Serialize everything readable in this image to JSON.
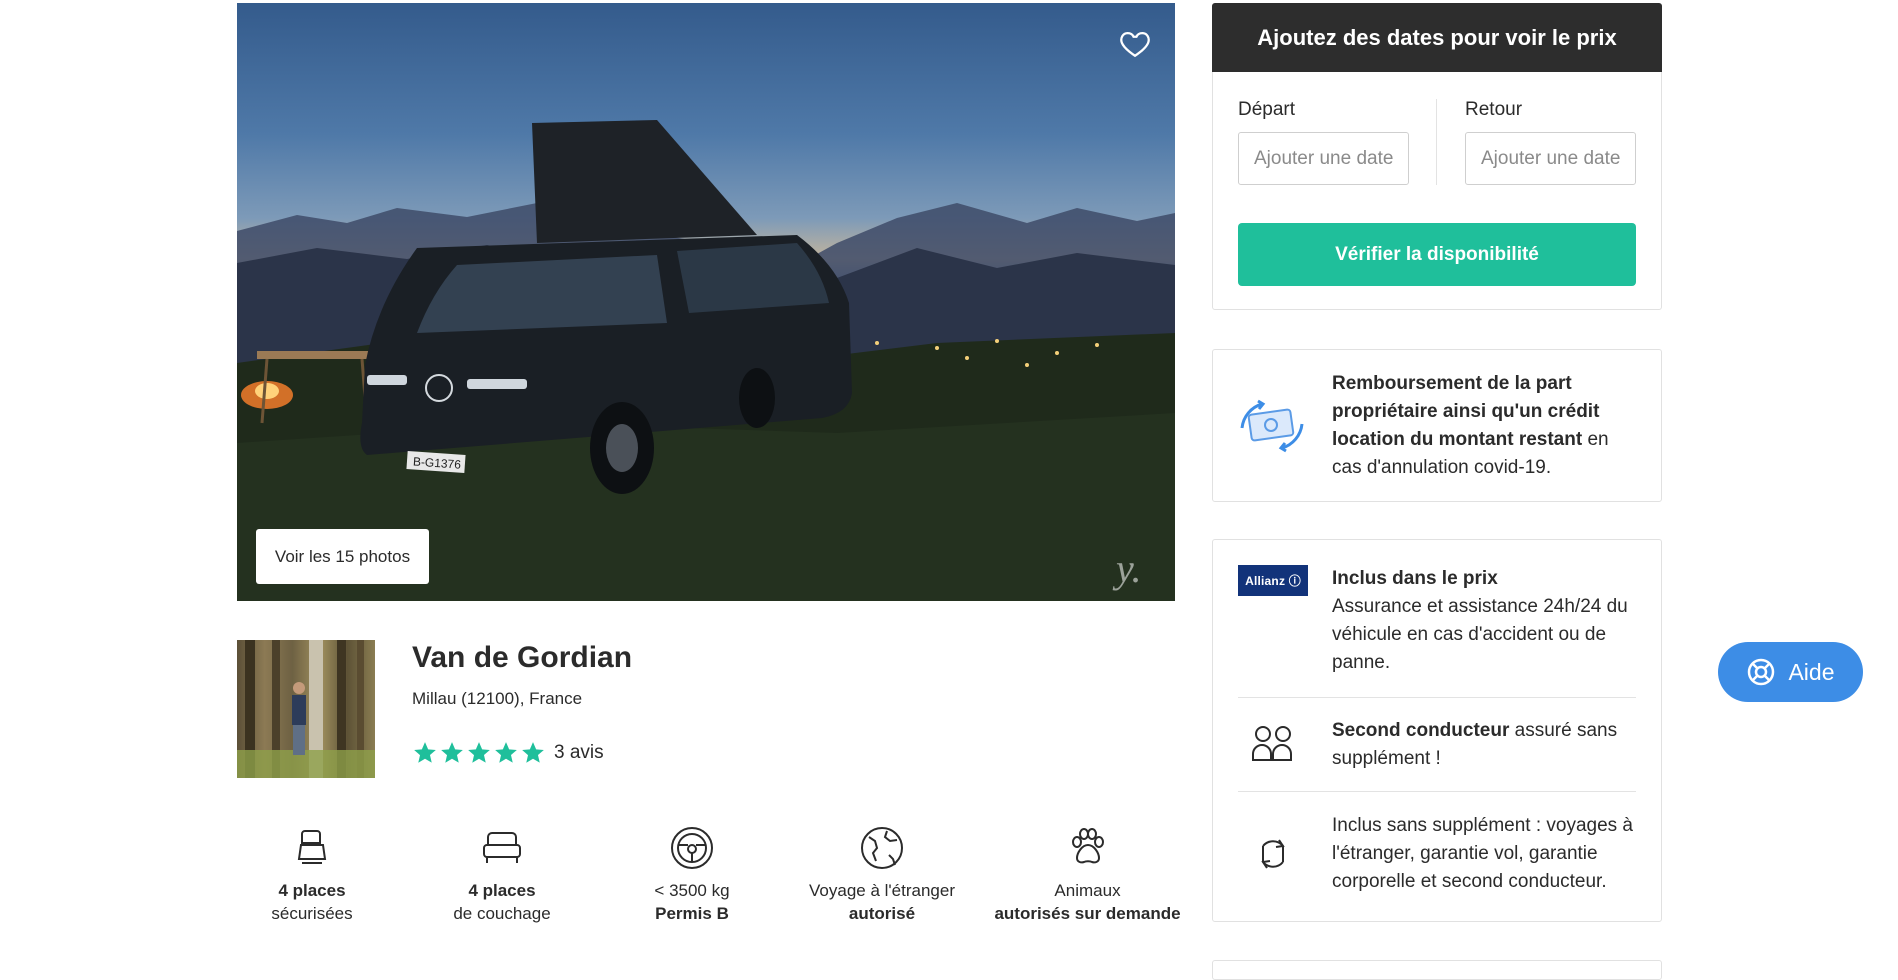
{
  "hero": {
    "photos_button": "Voir les 15 photos",
    "watermark": "y.",
    "plate": "B-G1376"
  },
  "listing": {
    "title": "Van de Gordian",
    "location": "Millau (12100), France",
    "rating": 5,
    "reviews": "3 avis"
  },
  "features": [
    {
      "icon": "seat-icon",
      "line1": "4 places",
      "line2": "sécurisées",
      "bold_line": 1
    },
    {
      "icon": "bed-icon",
      "line1": "4 places",
      "line2": "de couchage",
      "bold_line": 1
    },
    {
      "icon": "steering-wheel-icon",
      "line1": "< 3500 kg",
      "line2": "Permis B",
      "bold_line": 2
    },
    {
      "icon": "globe-icon",
      "line1": "Voyage à l'étranger",
      "line2": "autorisé",
      "bold_line": 2
    },
    {
      "icon": "paw-icon",
      "line1": "Animaux",
      "line2": "autorisés sur demande",
      "bold_line": 2
    }
  ],
  "booking": {
    "header": "Ajoutez des dates pour voir le prix",
    "departure_label": "Départ",
    "return_label": "Retour",
    "date_placeholder": "Ajouter une date",
    "check_button": "Vérifier la disponibilité"
  },
  "covid": {
    "bold": "Remboursement de la part propriétaire ainsi qu'un crédit location du montant restant",
    "rest": " en cas d'annulation covid-19."
  },
  "insurance": {
    "logo_text": "Allianz ⓘ",
    "item1_bold": "Inclus dans le prix",
    "item1_text": "Assurance et assistance 24h/24 du véhicule en cas d'accident ou de panne.",
    "item2_bold": "Second conducteur",
    "item2_text": " assuré sans supplément !",
    "item3_text": "Inclus sans supplément : voyages à l'étranger, garantie vol, garantie corporelle et second conducteur."
  },
  "help": {
    "label": "Aide"
  },
  "colors": {
    "accent": "#1fbf9b",
    "header_bg": "#2d2d2d",
    "help_blue": "#3d8de6",
    "allianz_blue": "#12337a"
  }
}
